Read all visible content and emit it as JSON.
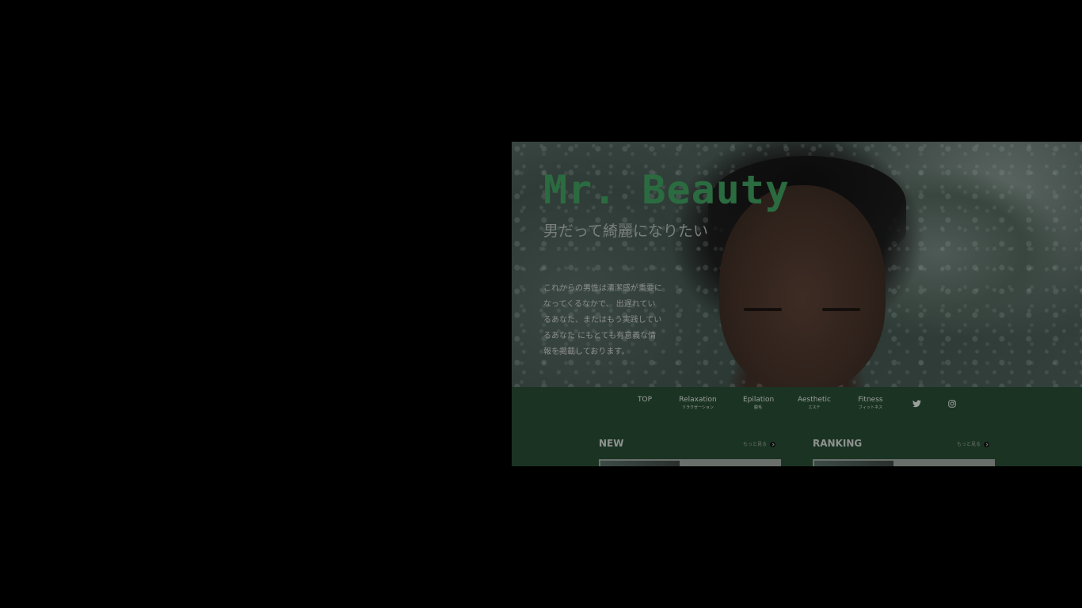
{
  "hero": {
    "brand": "Mr. Beauty",
    "tagline": "男だって綺麗になりたい",
    "intro_lines": [
      "これからの男性は清潔感が重要に",
      "なってくるなかで、 出遅れてい",
      "るあなた、またはもう実践してい",
      "るあなた にもとても有意義な情",
      "報を掲載しております。"
    ]
  },
  "nav": {
    "items": [
      {
        "label": "TOP",
        "sub": ""
      },
      {
        "label": "Relaxation",
        "sub": "リラクゼーション"
      },
      {
        "label": "Epilation",
        "sub": "脱毛"
      },
      {
        "label": "Aesthetic",
        "sub": "エステ"
      },
      {
        "label": "Fitness",
        "sub": "フィットネス"
      }
    ],
    "icons": [
      "twitter-icon",
      "instagram-icon"
    ]
  },
  "sections": {
    "new": {
      "title": "NEW",
      "more": "もっと見る"
    },
    "ranking": {
      "title": "RANKING",
      "more": "もっと見る"
    }
  },
  "colors": {
    "background": "#000000",
    "brand_green": "#2b6b40",
    "band_green": "#1b3323"
  }
}
